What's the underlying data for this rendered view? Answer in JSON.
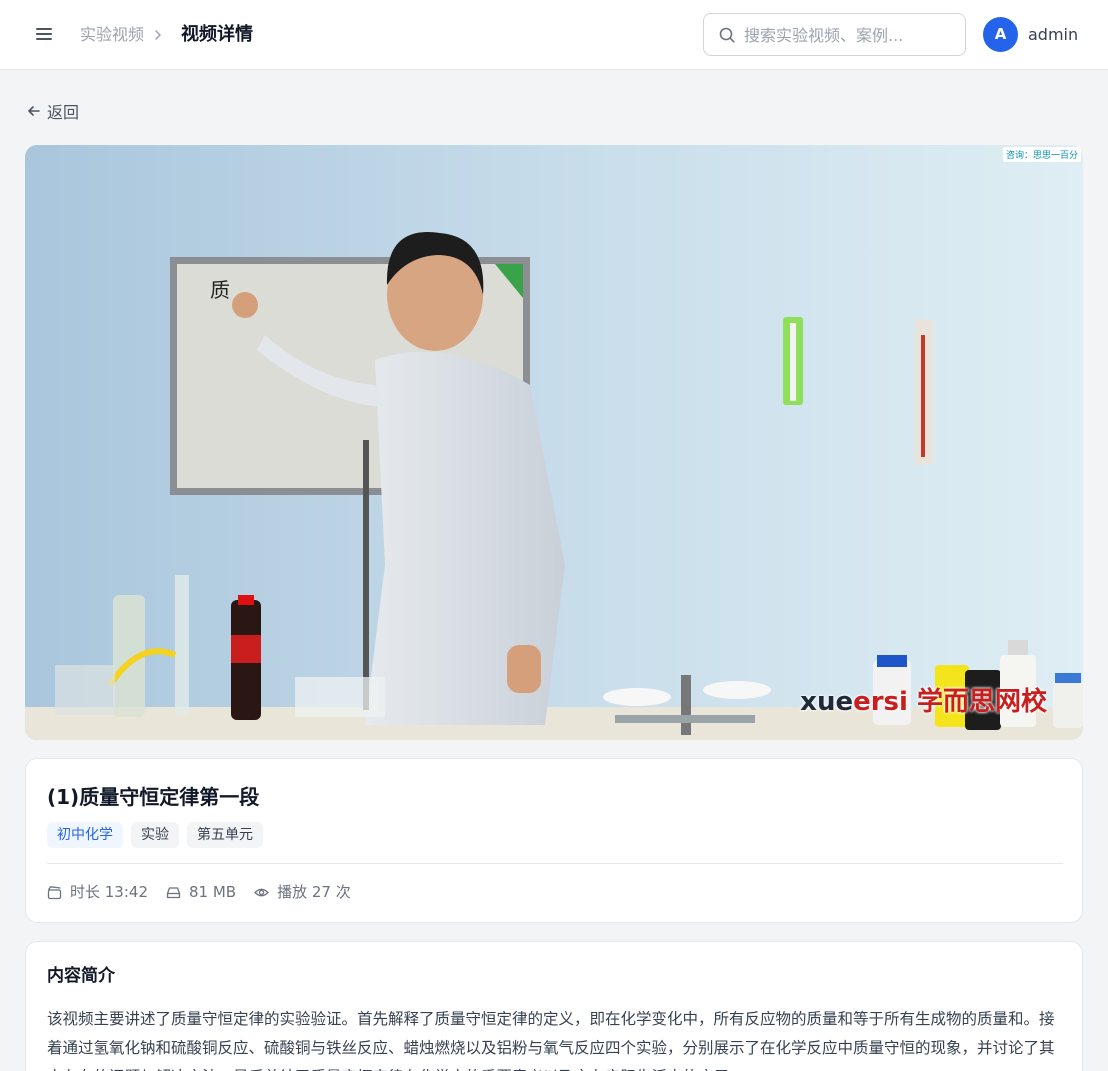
{
  "header": {
    "menu_icon": "menu-icon",
    "breadcrumb_parent": "实验视频",
    "breadcrumb_current": "视频详情",
    "search_placeholder": "搜索实验视频、案例...",
    "avatar_initial": "A",
    "username": "admin",
    "accent_color": "#2563eb"
  },
  "back": {
    "label": "返回",
    "icon": "arrow-left-icon"
  },
  "video": {
    "watermark_en": "xue",
    "watermark_en_red": "ersi",
    "watermark_cn": " 学而思网校",
    "corner_tag": "咨询：思思一百分"
  },
  "detail": {
    "title": "(1)质量守恒定律第一段",
    "tags": [
      {
        "label": "初中化学",
        "style": "primary"
      },
      {
        "label": "实验",
        "style": "default"
      },
      {
        "label": "第五单元",
        "style": "default"
      }
    ],
    "duration": "时长 13:42",
    "size": "81 MB",
    "plays": "播放 27 次"
  },
  "description": {
    "heading": "内容简介",
    "text": "该视频主要讲述了质量守恒定律的实验验证。首先解释了质量守恒定律的定义，即在化学变化中，所有反应物的质量和等于所有生成物的质量和。接着通过氢氧化钠和硫酸铜反应、硫酸铜与铁丝反应、蜡烛燃烧以及铝粉与氧气反应四个实验，分别展示了在化学反应中质量守恒的现象，并讨论了其中存在的问题与解决方法，最后总结了质量守恒定律在化学中的重要意义以及它在实际生活中的应用。"
  }
}
